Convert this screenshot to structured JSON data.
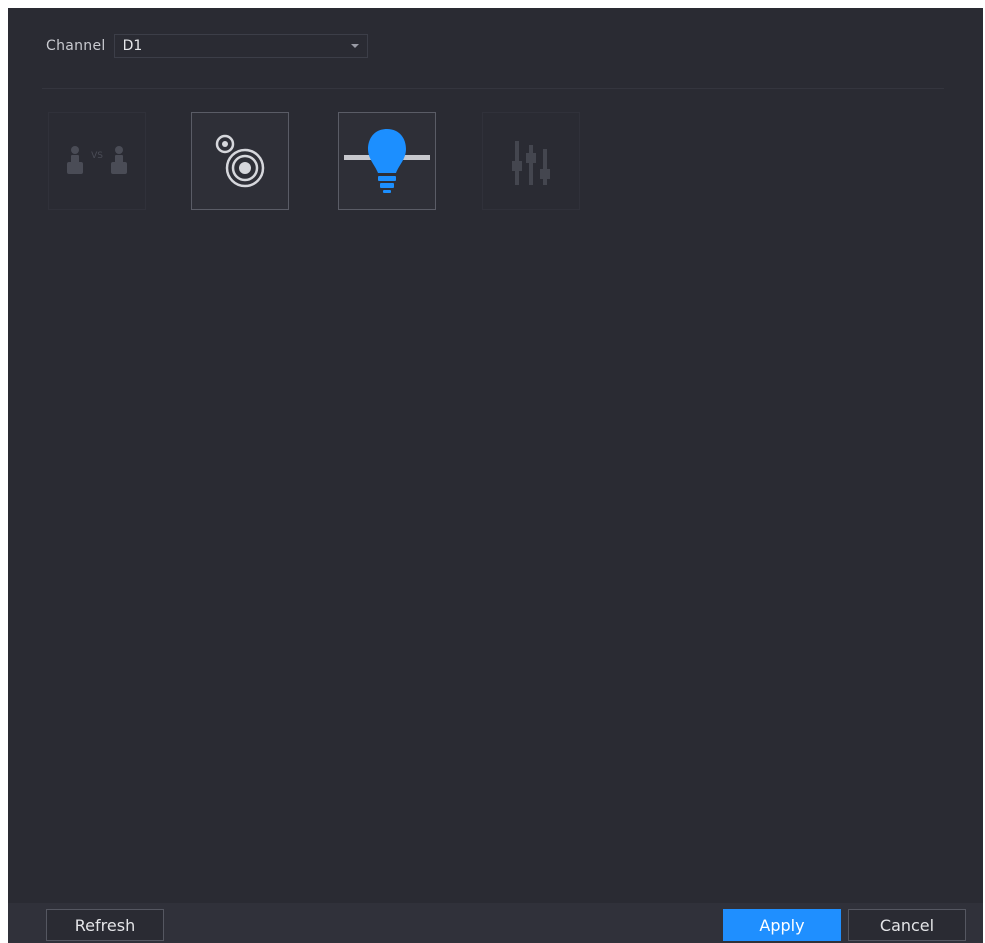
{
  "channel": {
    "label": "Channel",
    "value": "D1"
  },
  "tools": [
    {
      "name": "people-counting-icon",
      "enabled": false
    },
    {
      "name": "focus-target-icon",
      "enabled": true
    },
    {
      "name": "lightbulb-icon",
      "enabled": true,
      "accent": "#1c8fff"
    },
    {
      "name": "equalizer-icon",
      "enabled": false
    }
  ],
  "buttons": {
    "refresh": "Refresh",
    "apply": "Apply",
    "cancel": "Cancel"
  },
  "colors": {
    "background": "#2a2b33",
    "accent": "#1f8fff"
  }
}
